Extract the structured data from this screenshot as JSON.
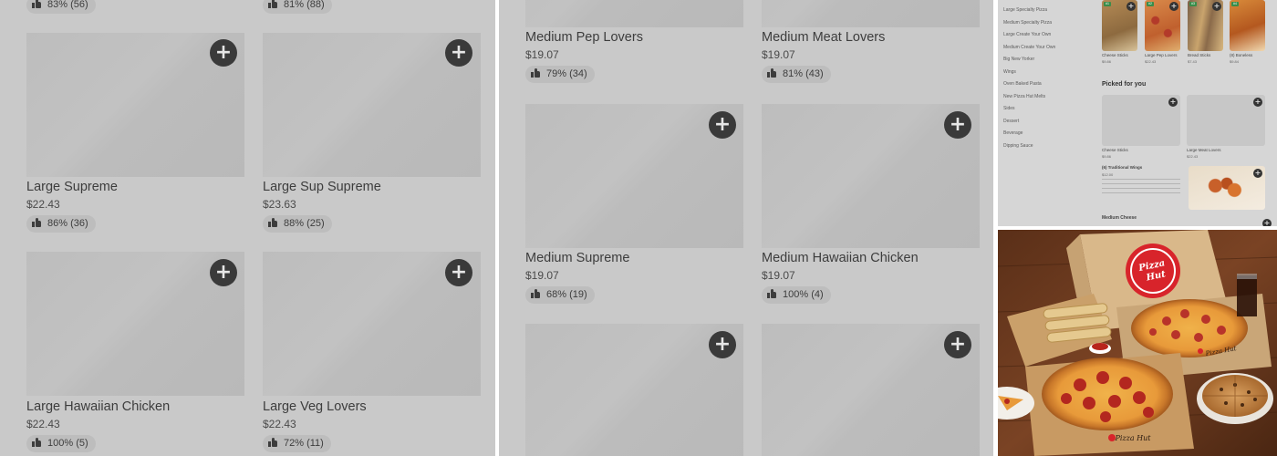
{
  "panel_a": {
    "top_ratings": [
      "83% (56)",
      "81% (88)"
    ],
    "items": [
      {
        "name": "Large Supreme",
        "price": "$22.43",
        "rating": "86% (36)"
      },
      {
        "name": "Large Sup Supreme",
        "price": "$23.63",
        "rating": "88% (25)"
      },
      {
        "name": "Large Hawaiian Chicken",
        "price": "$22.43",
        "rating": "100% (5)"
      },
      {
        "name": "Large Veg Lovers",
        "price": "$22.43",
        "rating": "72% (11)"
      }
    ]
  },
  "panel_b": {
    "items": [
      {
        "name": "Medium Pep Lovers",
        "price": "$19.07",
        "rating": "79% (34)"
      },
      {
        "name": "Medium Meat Lovers",
        "price": "$19.07",
        "rating": "81% (43)"
      },
      {
        "name": "Medium Supreme",
        "price": "$19.07",
        "rating": "68% (19)"
      },
      {
        "name": "Medium Hawaiian Chicken",
        "price": "$19.07",
        "rating": "100% (4)"
      }
    ]
  },
  "panel_c": {
    "categories": [
      "Large Specialty Pizza",
      "Medium Specialty Pizza",
      "Large Create Your Own",
      "Medium Create Your Own",
      "Big New Yorker",
      "Wings",
      "Oven Baked Pasta",
      "New Pizza Hut Melts",
      "Sides",
      "Dessert",
      "Beverage",
      "Dipping Sauce"
    ],
    "top_row": [
      {
        "name": "Cheese Sticks",
        "price": "$9.86"
      },
      {
        "name": "Large Pep Lovers",
        "price": "$22.43"
      },
      {
        "name": "Bread Sticks",
        "price": "$7.43"
      },
      {
        "name": "(8) Boneless",
        "price": "$9.84"
      }
    ],
    "picked_title": "Picked for you",
    "picked": [
      {
        "name": "Cheese Sticks",
        "price": "$9.86"
      },
      {
        "name": "Large Meat Lovers",
        "price": "$22.43"
      }
    ],
    "wings": {
      "name": "(6) Traditional Wings",
      "price": "$12.00"
    },
    "bottom_item": "Medium Cheese"
  },
  "panel_d": {
    "box_logo_text": "Pizza Hut"
  },
  "colors": {
    "panel_bg": "#c9c9c9",
    "add_button": "#3a3a3a",
    "pizza_hut_red": "#d8242b",
    "wood": "#6b3a1f"
  }
}
